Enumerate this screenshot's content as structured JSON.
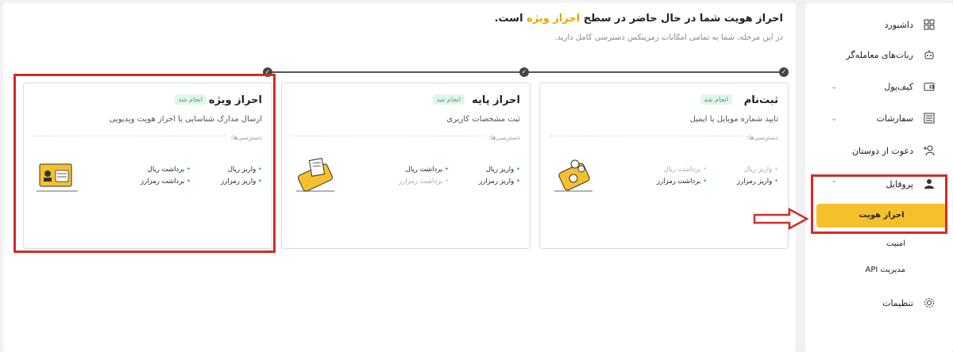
{
  "heading": {
    "prefix": "احراز هویت شما در حال حاضر در سطح",
    "highlight": "احراز ویژه",
    "suffix": "است.",
    "subtitle": "در این مرحله، شما به تمامی امکانات رمزینکس دسترسی کامل دارید."
  },
  "cards": [
    {
      "title": "ثبت‌نام",
      "badge": "انجام شد",
      "desc": "تایید شماره موبایل یا ایمیل",
      "access": "دسترسی‌ها:",
      "perms": [
        {
          "label": "واریز ریال",
          "enabled": false
        },
        {
          "label": "برداشت ریال",
          "enabled": false
        },
        {
          "label": "واریز رمزارز",
          "enabled": true
        },
        {
          "label": "برداشت رمزارز",
          "enabled": true
        }
      ]
    },
    {
      "title": "احراز پایه",
      "badge": "انجام شد",
      "desc": "ثبت مشخصات کاربری",
      "access": "دسترسی‌ها:",
      "perms": [
        {
          "label": "واریز ریال",
          "enabled": true
        },
        {
          "label": "برداشت ریال",
          "enabled": true
        },
        {
          "label": "واریز رمزارز",
          "enabled": true
        },
        {
          "label": "برداشت رمزارز",
          "enabled": false
        }
      ]
    },
    {
      "title": "احراز ویژه",
      "badge": "انجام شد",
      "desc": "ارسال مدارک شناسایی یا احراز هویت ویدیویی",
      "access": "دسترسی‌ها:",
      "perms": [
        {
          "label": "واریز ریال",
          "enabled": true
        },
        {
          "label": "برداشت ریال",
          "enabled": true
        },
        {
          "label": "واریز رمزارز",
          "enabled": true
        },
        {
          "label": "برداشت رمزارز",
          "enabled": true
        }
      ]
    }
  ],
  "sidebar": {
    "items": [
      {
        "label": "داشبورد",
        "icon": "grid-icon"
      },
      {
        "label": "ربات‌های معامله‌گر",
        "icon": "robot-icon"
      },
      {
        "label": "کیف‌پول",
        "icon": "wallet-icon"
      },
      {
        "label": "سفارشات",
        "icon": "list-icon"
      },
      {
        "label": "دعوت از دوستان",
        "icon": "add-user-icon"
      },
      {
        "label": "پروفایل",
        "icon": "user-icon"
      },
      {
        "label": "تنظیمات",
        "icon": "gear-icon"
      }
    ],
    "profile_sub": {
      "active": "احراز هویت",
      "security": "امنیت",
      "api": "مدیریت API"
    }
  },
  "colors": {
    "accent": "#f6c02c",
    "done_badge": "#2fa862",
    "highlight": "#d42a2a"
  }
}
